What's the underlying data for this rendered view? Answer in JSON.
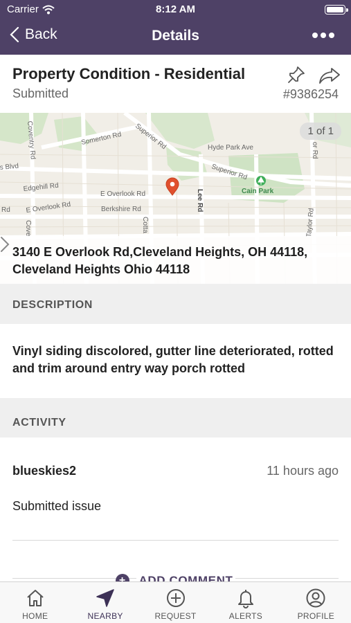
{
  "status_bar": {
    "carrier": "Carrier",
    "time": "8:12 AM"
  },
  "nav": {
    "back_label": "Back",
    "title": "Details"
  },
  "request": {
    "title": "Property Condition - Residential",
    "status": "Submitted",
    "number": "#9386254"
  },
  "map": {
    "pager": "1 of 1",
    "street_labels": [
      "Superior Rd",
      "Somerton Rd",
      "Hyde Park Ave",
      "Coventry Rd",
      "s Blvd",
      "Superior Rd",
      "Edgehill Rd",
      "E Overlook Rd",
      "Lee Rd",
      "Cain Park",
      "Rd",
      "E Overlook Rd",
      "Berkshire Rd",
      "Cotta",
      "Taylor Rd",
      "or Rd",
      "Cove"
    ],
    "address": "3140 E Overlook Rd,Cleveland Heights, OH 44118, Cleveland Heights Ohio 44118"
  },
  "description": {
    "header": "DESCRIPTION",
    "text": "Vinyl siding discolored, gutter line deteriorated, rotted and trim around entry way porch rotted"
  },
  "activity": {
    "header": "ACTIVITY",
    "user": "blueskies2",
    "time": "11 hours ago",
    "text": "Submitted issue",
    "add_comment": "ADD COMMENT"
  },
  "tabs": [
    {
      "label": "HOME",
      "icon": "home-icon"
    },
    {
      "label": "NEARBY",
      "icon": "nearby-arrow-icon"
    },
    {
      "label": "REQUEST",
      "icon": "add-circle-icon"
    },
    {
      "label": "ALERTS",
      "icon": "bell-icon"
    },
    {
      "label": "PROFILE",
      "icon": "profile-icon"
    }
  ],
  "colors": {
    "header_bg": "#4e4166",
    "map_pin": "#e0502e",
    "park": "#cfe3c4"
  }
}
